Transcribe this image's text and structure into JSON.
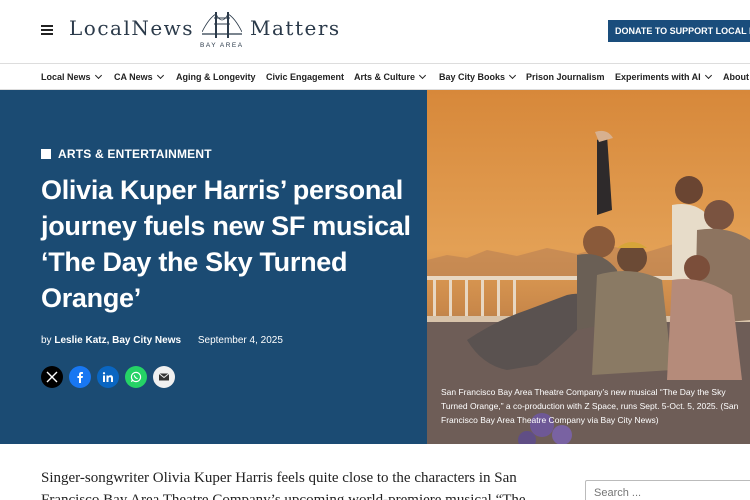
{
  "header": {
    "logo_local_news": "LocalNews",
    "logo_matters": "Matters",
    "logo_bay_area": "BAY AREA",
    "donate_label": "DONATE TO SUPPORT LOCAL NEWS!"
  },
  "nav": {
    "items": [
      {
        "label": "Local News"
      },
      {
        "label": "CA News"
      },
      {
        "label": "Aging & Longevity"
      },
      {
        "label": "Civic Engagement"
      },
      {
        "label": "Arts & Culture"
      },
      {
        "label": "Bay City Books"
      },
      {
        "label": "Prison Journalism"
      },
      {
        "label": "Experiments with AI"
      },
      {
        "label": "About U"
      }
    ]
  },
  "article": {
    "category": "ARTS & ENTERTAINMENT",
    "headline": "Olivia Kuper Harris’ personal journey fuels new SF musical ‘The Day the Sky Turned Orange’",
    "by": "by",
    "author": "Leslie Katz, Bay City News",
    "date": "September 4, 2025",
    "caption": "San Francisco Bay Area Theatre Company’s new musical “The Day the Sky Turned Orange,” a co-production with Z Space, runs Sept. 5-Oct. 5, 2025. (San Francisco Bay Area Theatre Company via Bay City News)",
    "body_text": "Singer-songwriter Olivia Kuper Harris feels quite close to the characters in San Francisco Bay Area Theatre Company’s upcoming world-premiere musical “The"
  },
  "share_icons": [
    "x-icon",
    "facebook-icon",
    "linkedin-icon",
    "whatsapp-icon",
    "email-icon"
  ],
  "colors": {
    "hero_bg": "#1b4b73",
    "donate_bg": "#1a4d7c",
    "photo_sky": "#e09a4c"
  },
  "search": {
    "placeholder": "Search ..."
  }
}
